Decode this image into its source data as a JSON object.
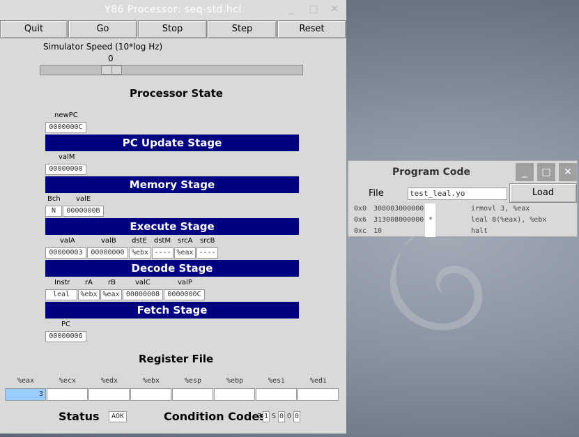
{
  "main_window": {
    "title": "Y86 Processor: seq-std.hcl",
    "buttons": [
      "Quit",
      "Go",
      "Stop",
      "Step",
      "Reset"
    ],
    "speed_label": "Simulator Speed (10*log Hz)",
    "speed_value": "0",
    "speed_level": 0.26,
    "processor_state_title": "Processor State",
    "pc_update": {
      "newpc_label": "newPC",
      "newpc": "0000000C",
      "stage": "PC Update Stage"
    },
    "memory": {
      "valm_label": "valM",
      "valm": "00000000",
      "stage": "Memory Stage"
    },
    "execute": {
      "bch_label": "Bch",
      "vale_label": "valE",
      "bch": "N",
      "vale": "0000000B",
      "stage": "Execute Stage"
    },
    "decode": {
      "labels": [
        "valA",
        "valB",
        "dstE",
        "dstM",
        "srcA",
        "srcB"
      ],
      "values": [
        "00000003",
        "00000000",
        "%ebx",
        "----",
        "%eax",
        "----"
      ],
      "stage": "Decode Stage"
    },
    "fetch": {
      "labels": [
        "Instr",
        "rA",
        "rB",
        "valC",
        "valP"
      ],
      "values": [
        "leal",
        "%ebx",
        "%eax",
        "00000008",
        "0000000C"
      ],
      "stage": "Fetch Stage"
    },
    "pc": {
      "label": "PC",
      "value": "00000006"
    },
    "register_file_title": "Register File",
    "registers": [
      {
        "name": "%eax",
        "value": "3",
        "highlight": "#99ccff"
      },
      {
        "name": "%ecx",
        "value": ""
      },
      {
        "name": "%edx",
        "value": ""
      },
      {
        "name": "%ebx",
        "value": ""
      },
      {
        "name": "%esp",
        "value": ""
      },
      {
        "name": "%ebp",
        "value": ""
      },
      {
        "name": "%esi",
        "value": ""
      },
      {
        "name": "%edi",
        "value": ""
      }
    ],
    "status_label": "Status",
    "status": "AOK",
    "cc_label": "Condition Codes",
    "cc": {
      "z_label": "Z",
      "z": "1",
      "s_label": "S",
      "s": "0",
      "o_label": "O",
      "o": "0"
    }
  },
  "code_window": {
    "title": "Program Code",
    "file_label": "File",
    "file_value": "test_leal.yo",
    "load_label": "Load",
    "lines": [
      {
        "addr": "0x0",
        "bytes": "308003000000",
        "mark": "",
        "asm": "irmovl 3, %eax"
      },
      {
        "addr": "0x6",
        "bytes": "313008000000",
        "mark": "*",
        "asm": "leal 8(%eax), %ebx"
      },
      {
        "addr": "0xc",
        "bytes": "10",
        "mark": "",
        "asm": "halt"
      }
    ]
  },
  "colors": {
    "stage_bar": "#000080",
    "window_bg": "#d9d9d9",
    "register_highlight": "#99ccff"
  },
  "icons": [
    "minimize-icon",
    "maximize-icon",
    "close-icon",
    "debian-swirl-logo"
  ]
}
